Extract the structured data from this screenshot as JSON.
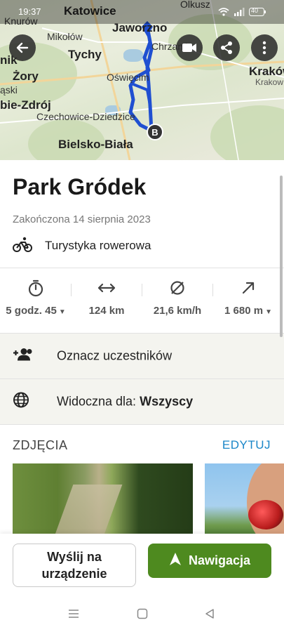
{
  "status_bar": {
    "time": "19:37",
    "battery": "40"
  },
  "map": {
    "labels": [
      "Katowice",
      "Olkusz",
      "Knurów",
      "Mikołów",
      "Jaworzno",
      "Chrzanów",
      "nik",
      "Tychy",
      "Kraków",
      "Żory",
      "Krakow",
      "Oświęcim",
      "ąski",
      "bie-Zdrój",
      "Czechowice-Dziedzice",
      "Bielsko-Biała"
    ],
    "marker_end": "B"
  },
  "route": {
    "title": "Park Gródek",
    "completed": "Zakończona 14 sierpnia 2023",
    "activity": "Turystyka rowerowa"
  },
  "stats": [
    {
      "icon": "stopwatch-icon",
      "value": "5 godz. 45",
      "dropdown": true
    },
    {
      "icon": "distance-arrows-icon",
      "value": "124 km",
      "dropdown": false
    },
    {
      "icon": "average-speed-icon",
      "value": "21,6 km/h",
      "dropdown": false
    },
    {
      "icon": "elevation-arrow-icon",
      "value": "1 680 m",
      "dropdown": true
    }
  ],
  "rows": {
    "tag_participants": "Oznacz uczestników",
    "visibility_prefix": "Widoczna dla:",
    "visibility_value": "Wszyscy"
  },
  "photos": {
    "header": "ZDJĘCIA",
    "edit": "EDYTUJ"
  },
  "actions": {
    "send_line1": "Wyślij na",
    "send_line2": "urządzenie",
    "navigate": "Nawigacja"
  },
  "colors": {
    "accent_green": "#4e8a1f",
    "link_blue": "#1a86c8",
    "route_blue": "#1f4fd1"
  }
}
